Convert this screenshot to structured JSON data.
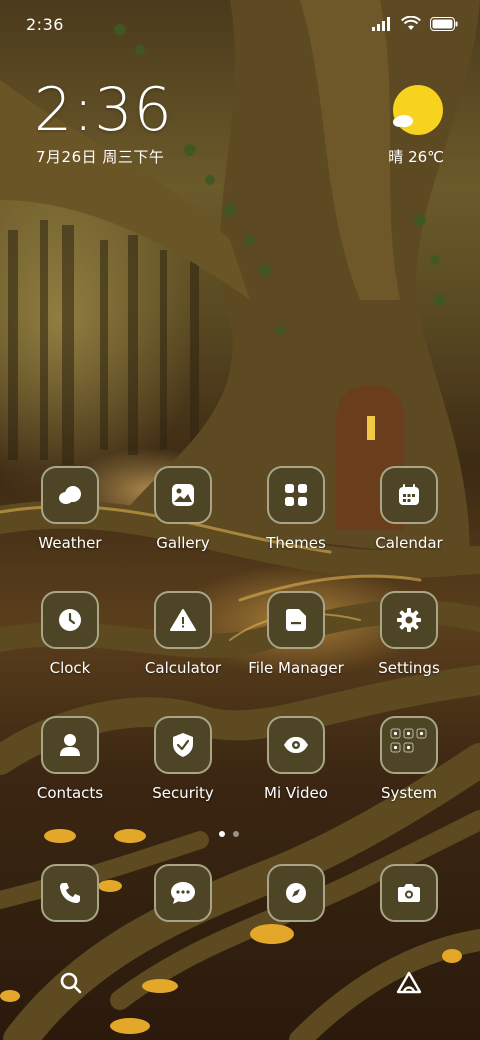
{
  "status_bar": {
    "time": "2:36",
    "icons": [
      "signal-icon",
      "wifi-icon",
      "battery-icon"
    ]
  },
  "clock_widget": {
    "time": "2:36",
    "date": "7月26日 周三下午"
  },
  "weather_widget": {
    "condition": "晴",
    "temperature": "26℃",
    "icon": "sunny-cloud-icon"
  },
  "apps": [
    {
      "label": "Weather",
      "icon": "weather-icon"
    },
    {
      "label": "Gallery",
      "icon": "gallery-icon"
    },
    {
      "label": "Themes",
      "icon": "themes-icon"
    },
    {
      "label": "Calendar",
      "icon": "calendar-icon"
    },
    {
      "label": "Clock",
      "icon": "clock-icon"
    },
    {
      "label": "Calculator",
      "icon": "calculator-icon"
    },
    {
      "label": "File Manager",
      "icon": "file-manager-icon"
    },
    {
      "label": "Settings",
      "icon": "settings-icon"
    },
    {
      "label": "Contacts",
      "icon": "contacts-icon"
    },
    {
      "label": "Security",
      "icon": "security-icon"
    },
    {
      "label": "Mi Video",
      "icon": "mi-video-icon"
    },
    {
      "label": "System",
      "icon": "system-folder-icon"
    }
  ],
  "page_indicator": {
    "pages": 2,
    "current": 1
  },
  "dock": [
    "phone-icon",
    "messages-icon",
    "browser-icon",
    "camera-icon"
  ],
  "bottom_bar": [
    "search-icon",
    "app-vault-icon"
  ],
  "colors": {
    "tile": "#4d4526",
    "tile_border": "#a9a586",
    "weather_sun": "#f7d21e"
  }
}
